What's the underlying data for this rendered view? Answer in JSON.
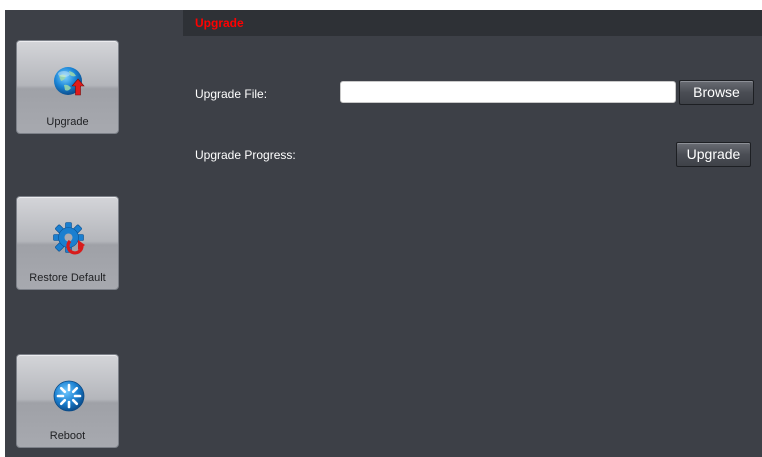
{
  "sidebar": {
    "items": [
      {
        "label": "Upgrade",
        "icon": "globe-upgrade-icon"
      },
      {
        "label": "Restore Default",
        "icon": "gear-restore-icon"
      },
      {
        "label": "Reboot",
        "icon": "reboot-spinner-icon"
      }
    ]
  },
  "main": {
    "title": "Upgrade",
    "upgrade_file_label": "Upgrade File:",
    "upgrade_file_value": "",
    "browse_label": "Browse",
    "upgrade_progress_label": "Upgrade Progress:",
    "upgrade_button_label": "Upgrade"
  },
  "colors": {
    "panel_bg": "#3d4047",
    "header_bg": "#2e3136",
    "title_color": "#ff0000",
    "text_color": "#ffffff"
  }
}
